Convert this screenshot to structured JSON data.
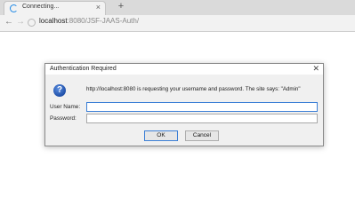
{
  "browser": {
    "tab": {
      "title": "Connecting...",
      "close_glyph": "×",
      "loading_icon": "spinner-icon"
    },
    "new_tab_glyph": "+",
    "nav": {
      "back_glyph": "←",
      "forward_glyph": "→",
      "reload_icon": "reload-icon"
    },
    "address": {
      "host": "localhost",
      "rest": ":8080/JSF-JAAS-Auth/"
    }
  },
  "dialog": {
    "title": "Authentication Required",
    "close_glyph": "✕",
    "icon": "question-icon",
    "icon_glyph": "?",
    "message": "http://localhost:8080 is requesting your username and password. The site says: \"Admin\"",
    "username_label": "User Name:",
    "username_value": "",
    "password_label": "Password:",
    "password_value": "",
    "ok_label": "OK",
    "cancel_label": "Cancel"
  },
  "colors": {
    "accent": "#3c7fd6",
    "spinner": "#1e88e5",
    "dialog_body": "#f0f0f0"
  }
}
